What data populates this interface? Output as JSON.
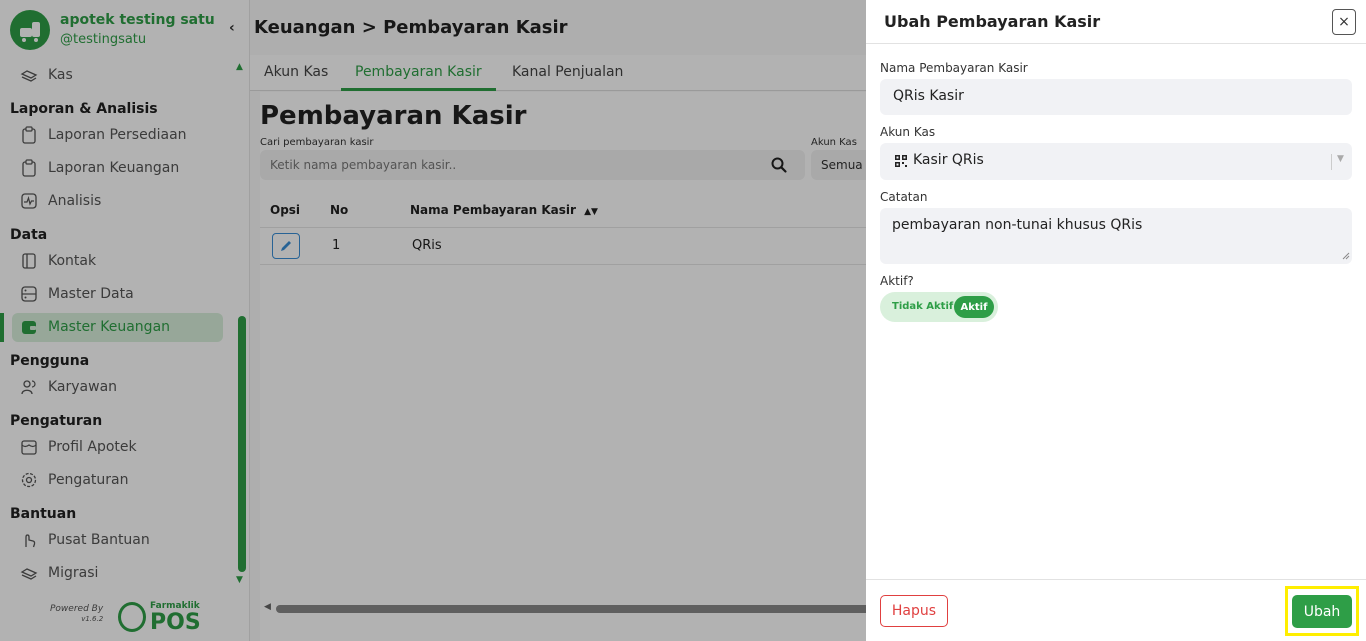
{
  "colors": {
    "brand": "#2e9e47",
    "danger": "#e04040",
    "highlight": "#ffee00",
    "link": "#3a8fd6"
  },
  "sidebar": {
    "brand_name": "apotek testing satu",
    "brand_handle": "@testingsatu",
    "items": [
      {
        "label": "Kas",
        "icon": "cash-icon"
      },
      {
        "section": "Laporan & Analisis"
      },
      {
        "label": "Laporan Persediaan",
        "icon": "clipboard-icon"
      },
      {
        "label": "Laporan Keuangan",
        "icon": "clipboard-icon"
      },
      {
        "label": "Analisis",
        "icon": "chart-icon"
      },
      {
        "section": "Data"
      },
      {
        "label": "Kontak",
        "icon": "book-icon"
      },
      {
        "label": "Master Data",
        "icon": "database-icon"
      },
      {
        "label": "Master Keuangan",
        "icon": "wallet-icon",
        "active": true
      },
      {
        "section": "Pengguna"
      },
      {
        "label": "Karyawan",
        "icon": "users-icon"
      },
      {
        "section": "Pengaturan"
      },
      {
        "label": "Profil Apotek",
        "icon": "store-icon"
      },
      {
        "label": "Pengaturan",
        "icon": "gear-icon"
      },
      {
        "section": "Bantuan"
      },
      {
        "label": "Pusat Bantuan",
        "icon": "hand-icon"
      },
      {
        "label": "Migrasi",
        "icon": "transfer-icon"
      }
    ],
    "powered_by": "Powered By",
    "version": "v1.6.2",
    "pos_brand": "Farmaklik",
    "pos_word": "POS"
  },
  "main": {
    "breadcrumb": "Keuangan > Pembayaran Kasir",
    "tabs": [
      {
        "label": "Akun Kas"
      },
      {
        "label": "Pembayaran Kasir",
        "active": true
      },
      {
        "label": "Kanal Penjualan"
      }
    ],
    "page_title": "Pembayaran Kasir",
    "search_label": "Cari pembayaran kasir",
    "search_placeholder": "Ketik nama pembayaran kasir..",
    "akun_label": "Akun Kas",
    "akun_value": "Semua",
    "table": {
      "headers": [
        "Opsi",
        "No",
        "Nama Pembayaran Kasir"
      ],
      "rows": [
        {
          "no": "1",
          "name": "QRis"
        }
      ]
    }
  },
  "drawer": {
    "title": "Ubah Pembayaran Kasir",
    "close": "×",
    "name_label": "Nama Pembayaran Kasir",
    "name_value": "QRis Kasir",
    "akun_label": "Akun Kas",
    "akun_value": "Kasir QRis",
    "akun_icon": "qr-icon",
    "note_label": "Catatan",
    "note_value": "pembayaran non-tunai khusus QRis",
    "active_label": "Aktif?",
    "toggle_off": "Tidak Aktif",
    "toggle_on": "Aktif",
    "delete_label": "Hapus",
    "submit_label": "Ubah"
  }
}
